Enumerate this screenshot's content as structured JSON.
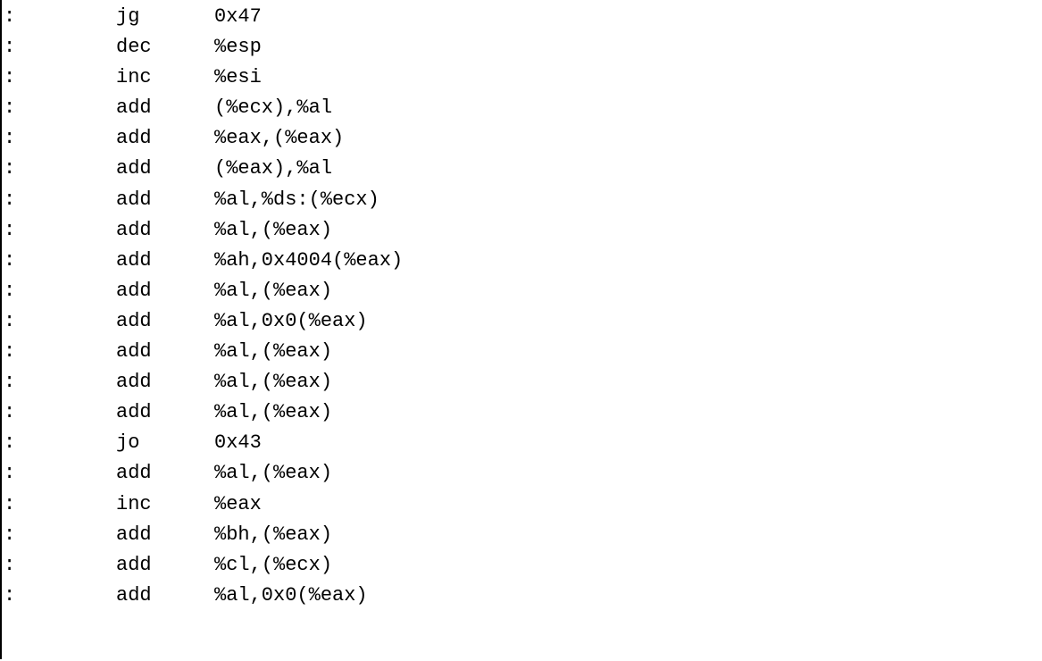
{
  "disassembly": {
    "lines": [
      {
        "colon": ":",
        "mnemonic": "jg",
        "operands": "0x47"
      },
      {
        "colon": ":",
        "mnemonic": "dec",
        "operands": "%esp"
      },
      {
        "colon": ":",
        "mnemonic": "inc",
        "operands": "%esi"
      },
      {
        "colon": ":",
        "mnemonic": "add",
        "operands": "(%ecx),%al"
      },
      {
        "colon": ":",
        "mnemonic": "add",
        "operands": "%eax,(%eax)"
      },
      {
        "colon": ":",
        "mnemonic": "add",
        "operands": "(%eax),%al"
      },
      {
        "colon": ":",
        "mnemonic": "add",
        "operands": "%al,%ds:(%ecx)"
      },
      {
        "colon": ":",
        "mnemonic": "add",
        "operands": "%al,(%eax)"
      },
      {
        "colon": ":",
        "mnemonic": "add",
        "operands": "%ah,0x4004(%eax)"
      },
      {
        "colon": ":",
        "mnemonic": "add",
        "operands": "%al,(%eax)"
      },
      {
        "colon": ":",
        "mnemonic": "add",
        "operands": "%al,0x0(%eax)"
      },
      {
        "colon": ":",
        "mnemonic": "add",
        "operands": "%al,(%eax)"
      },
      {
        "colon": ":",
        "mnemonic": "add",
        "operands": "%al,(%eax)"
      },
      {
        "colon": ":",
        "mnemonic": "add",
        "operands": "%al,(%eax)"
      },
      {
        "colon": ":",
        "mnemonic": "jo",
        "operands": "0x43"
      },
      {
        "colon": ":",
        "mnemonic": "add",
        "operands": "%al,(%eax)"
      },
      {
        "colon": ":",
        "mnemonic": "inc",
        "operands": "%eax"
      },
      {
        "colon": ":",
        "mnemonic": "add",
        "operands": "%bh,(%eax)"
      },
      {
        "colon": ":",
        "mnemonic": "add",
        "operands": "%cl,(%ecx)"
      },
      {
        "colon": ":",
        "mnemonic": "add",
        "operands": "%al,0x0(%eax)"
      }
    ]
  }
}
